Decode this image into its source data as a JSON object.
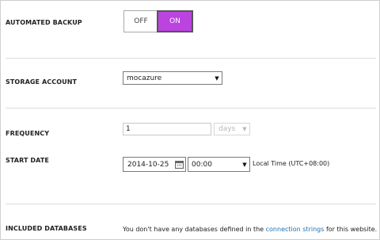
{
  "automated_backup": {
    "label": "AUTOMATED BACKUP",
    "off_label": "OFF",
    "on_label": "ON",
    "selected": "ON",
    "on_color": "#bb44e0"
  },
  "storage_account": {
    "label": "STORAGE ACCOUNT",
    "value": "mocazure"
  },
  "frequency": {
    "label": "FREQUENCY",
    "value": "1",
    "unit": "days"
  },
  "start_date": {
    "label": "START DATE",
    "date": "2014-10-25",
    "time": "00:00",
    "timezone": "Local Time (UTC+08:00)"
  },
  "included_databases": {
    "label": "INCLUDED DATABASES",
    "message_prefix": "You don't have any databases defined in the",
    "link_text": "connection strings",
    "message_suffix": "for this website."
  }
}
